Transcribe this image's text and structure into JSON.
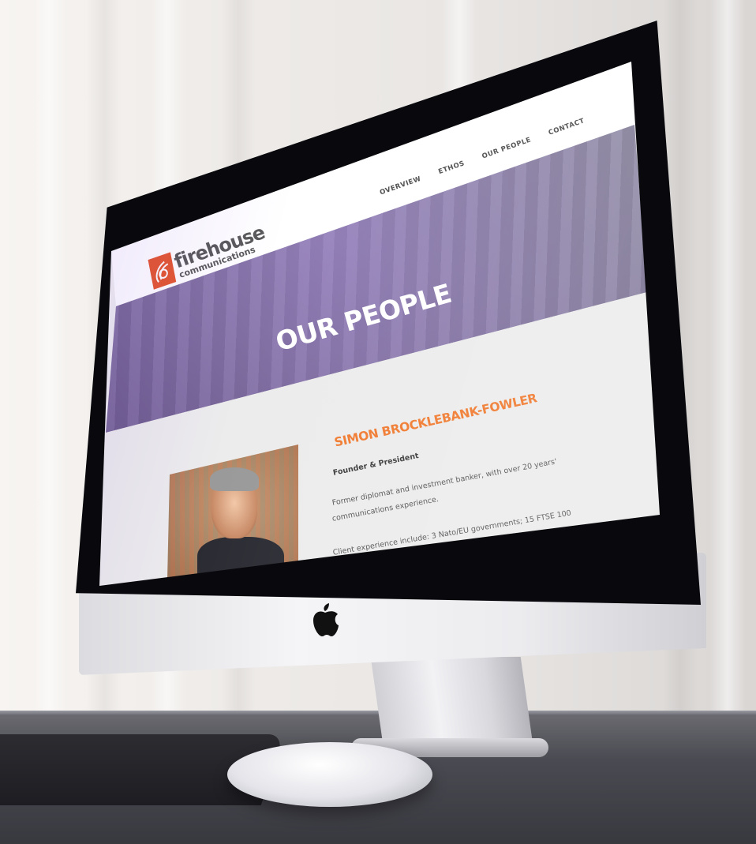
{
  "site": {
    "logo": {
      "line1": "firehouse",
      "line2": "communications"
    },
    "nav": [
      {
        "label": "OVERVIEW"
      },
      {
        "label": "ETHOS"
      },
      {
        "label": "OUR PEOPLE"
      },
      {
        "label": "CONTACT"
      }
    ],
    "hero_title": "OUR PEOPLE",
    "person": {
      "name": "SIMON BROCKLEBANK-FOWLER",
      "role": "Founder & President",
      "bio_line1": "Former diplomat and investment banker, with over 20 years'",
      "bio_line2": "communications experience.",
      "bio_line3": "Client experience include: 3 Nato/EU governments; 15 FTSE 100"
    }
  },
  "colors": {
    "accent_orange": "#f07a2f",
    "logo_red": "#e4572e",
    "hero_purple": "#6a5b86"
  },
  "icons": [
    "apple-logo-icon"
  ]
}
